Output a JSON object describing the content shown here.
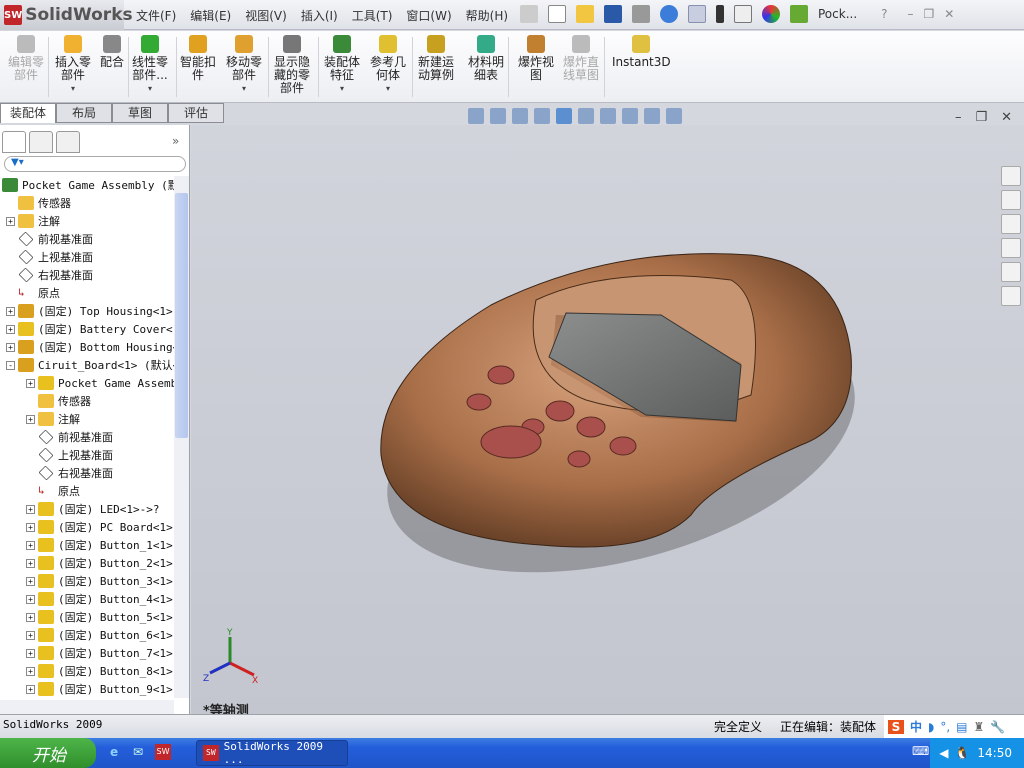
{
  "app": {
    "logo": "SolidWorks",
    "doc_title": "Pock..."
  },
  "menu": [
    "文件(F)",
    "编辑(E)",
    "视图(V)",
    "插入(I)",
    "工具(T)",
    "窗口(W)",
    "帮助(H)"
  ],
  "ribbon": [
    {
      "label": "编辑零\n部件",
      "disabled": true,
      "dropdown": false
    },
    {
      "label": "插入零\n部件",
      "disabled": false,
      "dropdown": true
    },
    {
      "label": "配合",
      "disabled": false,
      "dropdown": false
    },
    {
      "label": "线性零\n部件...",
      "disabled": false,
      "dropdown": true
    },
    {
      "label": "智能扣\n件",
      "disabled": false,
      "dropdown": false
    },
    {
      "label": "移动零\n部件",
      "disabled": false,
      "dropdown": true
    },
    {
      "label": "显示隐\n藏的零\n部件",
      "disabled": false,
      "dropdown": false
    },
    {
      "label": "装配体\n特征",
      "disabled": false,
      "dropdown": true
    },
    {
      "label": "参考几\n何体",
      "disabled": false,
      "dropdown": true
    },
    {
      "label": "新建运\n动算例",
      "disabled": false,
      "dropdown": false
    },
    {
      "label": "材料明\n细表",
      "disabled": false,
      "dropdown": false
    },
    {
      "label": "爆炸视\n图",
      "disabled": false,
      "dropdown": false
    },
    {
      "label": "爆炸直\n线草图",
      "disabled": true,
      "dropdown": false
    },
    {
      "label": "Instant3D",
      "disabled": false,
      "dropdown": false
    }
  ],
  "tabs": [
    {
      "label": "装配体",
      "active": true
    },
    {
      "label": "布局"
    },
    {
      "label": "草图"
    },
    {
      "label": "评估"
    }
  ],
  "tree": [
    {
      "level": 0,
      "exp": "",
      "icon": "assembly",
      "label": "Pocket Game Assembly  (默"
    },
    {
      "level": 1,
      "exp": "",
      "icon": "sensor",
      "label": "传感器"
    },
    {
      "level": 1,
      "exp": "+",
      "icon": "annotation",
      "label": "注解"
    },
    {
      "level": 1,
      "exp": "",
      "icon": "plane",
      "label": "前视基准面"
    },
    {
      "level": 1,
      "exp": "",
      "icon": "plane",
      "label": "上视基准面"
    },
    {
      "level": 1,
      "exp": "",
      "icon": "plane",
      "label": "右视基准面"
    },
    {
      "level": 1,
      "exp": "",
      "icon": "origin",
      "label": "原点"
    },
    {
      "level": 1,
      "exp": "+",
      "icon": "subassembly",
      "label": "(固定) Top Housing<1>-"
    },
    {
      "level": 1,
      "exp": "+",
      "icon": "part",
      "label": "(固定) Battery Cover<1"
    },
    {
      "level": 1,
      "exp": "+",
      "icon": "subassembly",
      "label": "(固定) Bottom Housing<"
    },
    {
      "level": 1,
      "exp": "-",
      "icon": "subassembly",
      "label": "Ciruit_Board<1> (默认<"
    },
    {
      "level": 2,
      "exp": "+",
      "icon": "mates",
      "label": "Pocket Game Assembl"
    },
    {
      "level": 2,
      "exp": "",
      "icon": "sensor",
      "label": "传感器"
    },
    {
      "level": 2,
      "exp": "+",
      "icon": "annotation",
      "label": "注解"
    },
    {
      "level": 2,
      "exp": "",
      "icon": "plane",
      "label": "前视基准面"
    },
    {
      "level": 2,
      "exp": "",
      "icon": "plane",
      "label": "上视基准面"
    },
    {
      "level": 2,
      "exp": "",
      "icon": "plane",
      "label": "右视基准面"
    },
    {
      "level": 2,
      "exp": "",
      "icon": "origin",
      "label": "原点"
    },
    {
      "level": 2,
      "exp": "+",
      "icon": "part",
      "label": "(固定) LED<1>->?"
    },
    {
      "level": 2,
      "exp": "+",
      "icon": "part",
      "label": "(固定) PC Board<1>"
    },
    {
      "level": 2,
      "exp": "+",
      "icon": "part",
      "label": "(固定) Button_1<1>"
    },
    {
      "level": 2,
      "exp": "+",
      "icon": "part",
      "label": "(固定) Button_2<1>"
    },
    {
      "level": 2,
      "exp": "+",
      "icon": "part",
      "label": "(固定) Button_3<1>"
    },
    {
      "level": 2,
      "exp": "+",
      "icon": "part",
      "label": "(固定) Button_4<1>"
    },
    {
      "level": 2,
      "exp": "+",
      "icon": "part",
      "label": "(固定) Button_5<1>"
    },
    {
      "level": 2,
      "exp": "+",
      "icon": "part",
      "label": "(固定) Button_6<1>"
    },
    {
      "level": 2,
      "exp": "+",
      "icon": "part",
      "label": "(固定) Button_7<1>"
    },
    {
      "level": 2,
      "exp": "+",
      "icon": "part",
      "label": "(固定) Button_8<1>"
    },
    {
      "level": 2,
      "exp": "+",
      "icon": "part",
      "label": "(固定) Button_9<1>"
    }
  ],
  "viewport": {
    "view_name": "*等轴测",
    "triad": {
      "x": "X",
      "y": "Y",
      "z": "Z"
    }
  },
  "status": {
    "left": "SolidWorks 2009",
    "fully_defined": "完全定义",
    "editing": "正在编辑：装配体",
    "ime": "中"
  },
  "taskbar": {
    "start": "开始",
    "task": "SolidWorks 2009 ...",
    "clock": "14:50"
  },
  "colors": {
    "model": "#b07a55",
    "viewport": "#c9ccd4",
    "taskbar": "#245edb"
  }
}
